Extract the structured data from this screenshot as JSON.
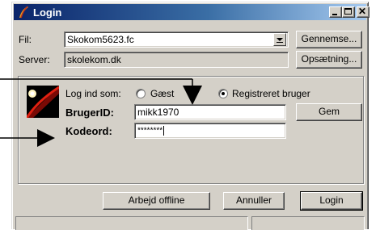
{
  "window": {
    "title": "Login",
    "app_icon": "feather-icon"
  },
  "titlebar_buttons": {
    "minimize": "minimize-icon",
    "maximize": "maximize-icon",
    "close": "✕"
  },
  "file": {
    "label": "Fil:",
    "value": "Skokom5623.fc",
    "browse_button": "Gennemse..."
  },
  "server": {
    "label": "Server:",
    "value": "skolekom.dk",
    "setup_button": "Opsætning..."
  },
  "login_as": {
    "label": "Log ind som:",
    "options": [
      {
        "label": "Gæst",
        "selected": false
      },
      {
        "label": "Registreret bruger",
        "selected": true
      }
    ]
  },
  "user": {
    "label": "BrugerID:",
    "value": "mikk1970",
    "save_button": "Gem"
  },
  "password": {
    "label": "Kodeord:",
    "value": "********"
  },
  "footer": {
    "offline_button": "Arbejd offline",
    "cancel_button": "Annuller",
    "login_button": "Login"
  },
  "colors": {
    "titlebar": "#0a246a",
    "titlebar_end": "#a6caf0",
    "face": "#d4d0c8",
    "annotation": "#000000"
  }
}
